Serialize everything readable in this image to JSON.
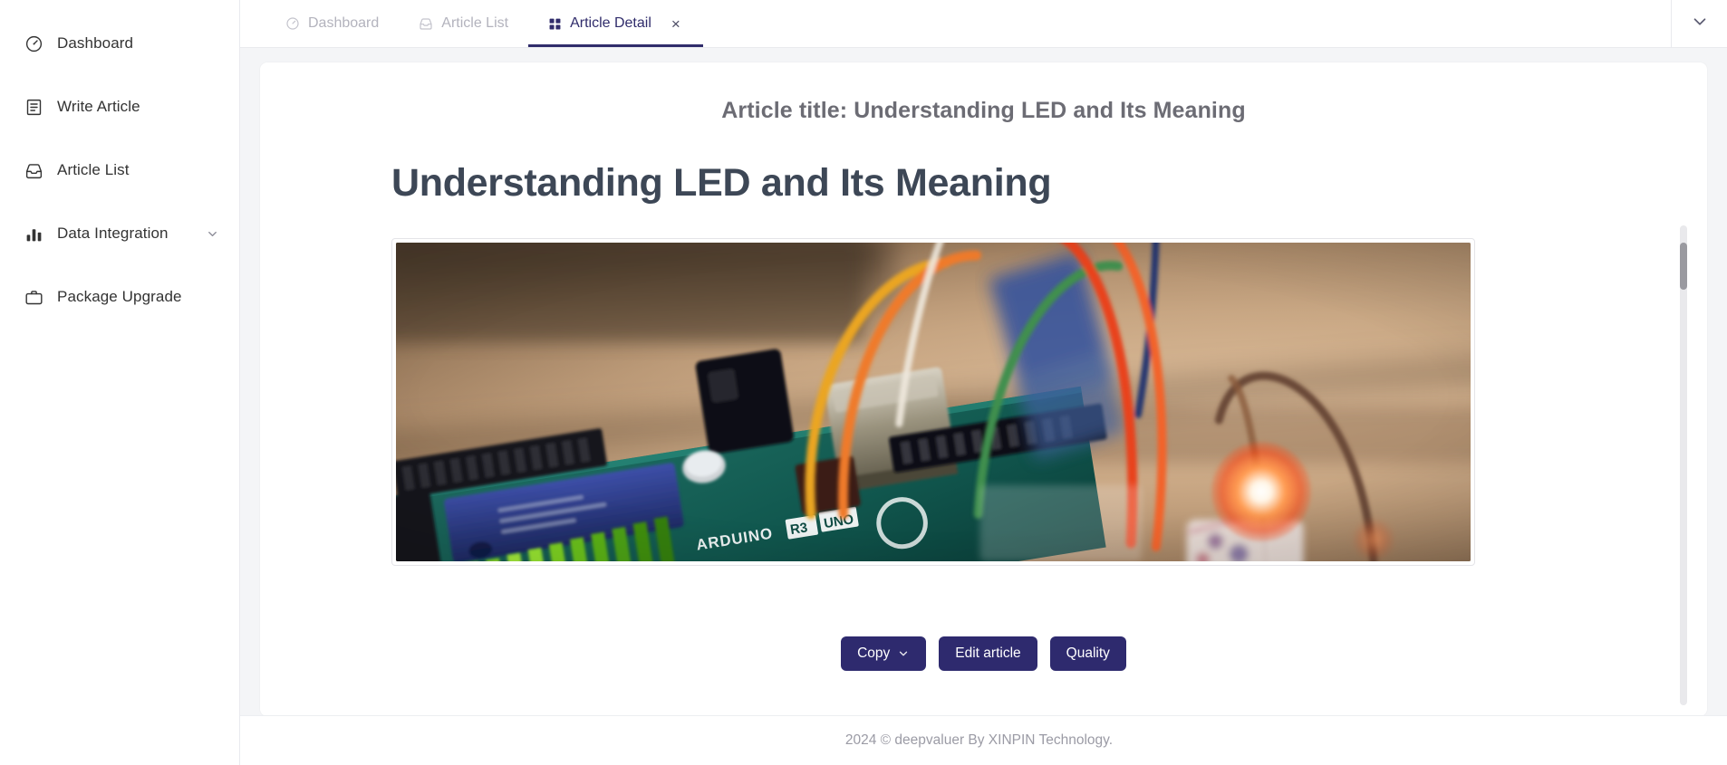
{
  "sidebar": {
    "items": [
      {
        "label": "Dashboard",
        "icon": "gauge-icon",
        "has_caret": false
      },
      {
        "label": "Write Article",
        "icon": "document-icon",
        "has_caret": false
      },
      {
        "label": "Article List",
        "icon": "inbox-icon",
        "has_caret": false
      },
      {
        "label": "Data Integration",
        "icon": "bar-chart-icon",
        "has_caret": true
      },
      {
        "label": "Package Upgrade",
        "icon": "briefcase-icon",
        "has_caret": false
      }
    ]
  },
  "tabbar": {
    "tabs": [
      {
        "label": "Dashboard",
        "icon": "gauge-icon",
        "active": false,
        "closable": false
      },
      {
        "label": "Article List",
        "icon": "inbox-icon",
        "active": false,
        "closable": false
      },
      {
        "label": "Article Detail",
        "icon": "grid-icon",
        "active": true,
        "closable": true
      }
    ],
    "close_glyph": "×",
    "collapse_icon": "chevron-down-icon"
  },
  "card": {
    "title_prefix": "Article title:",
    "title": "Article title: Understanding LED and Its Meaning"
  },
  "article": {
    "heading": "Understanding LED and Its Meaning",
    "figure_alt": "Close-up photo of an Arduino UNO R3 board with colored jumper wires and a glowing red LED"
  },
  "actions": {
    "copy_label": "Copy",
    "copy_caret": "chevron-down-icon",
    "edit_label": "Edit article",
    "quality_label": "Quality"
  },
  "footer": {
    "text": "2024 © deepvaluer By XINPIN Technology."
  },
  "scrollbar": {
    "thumb_position_percent": 4
  },
  "colors": {
    "accent": "#2e2a6e",
    "active_tab": "#302c6b",
    "heading": "#3d4756",
    "card_title": "#6c6c74",
    "muted_tab": "#b3b3bd",
    "page_bg": "#f4f5f7",
    "footer_text": "#9b9ba5"
  }
}
